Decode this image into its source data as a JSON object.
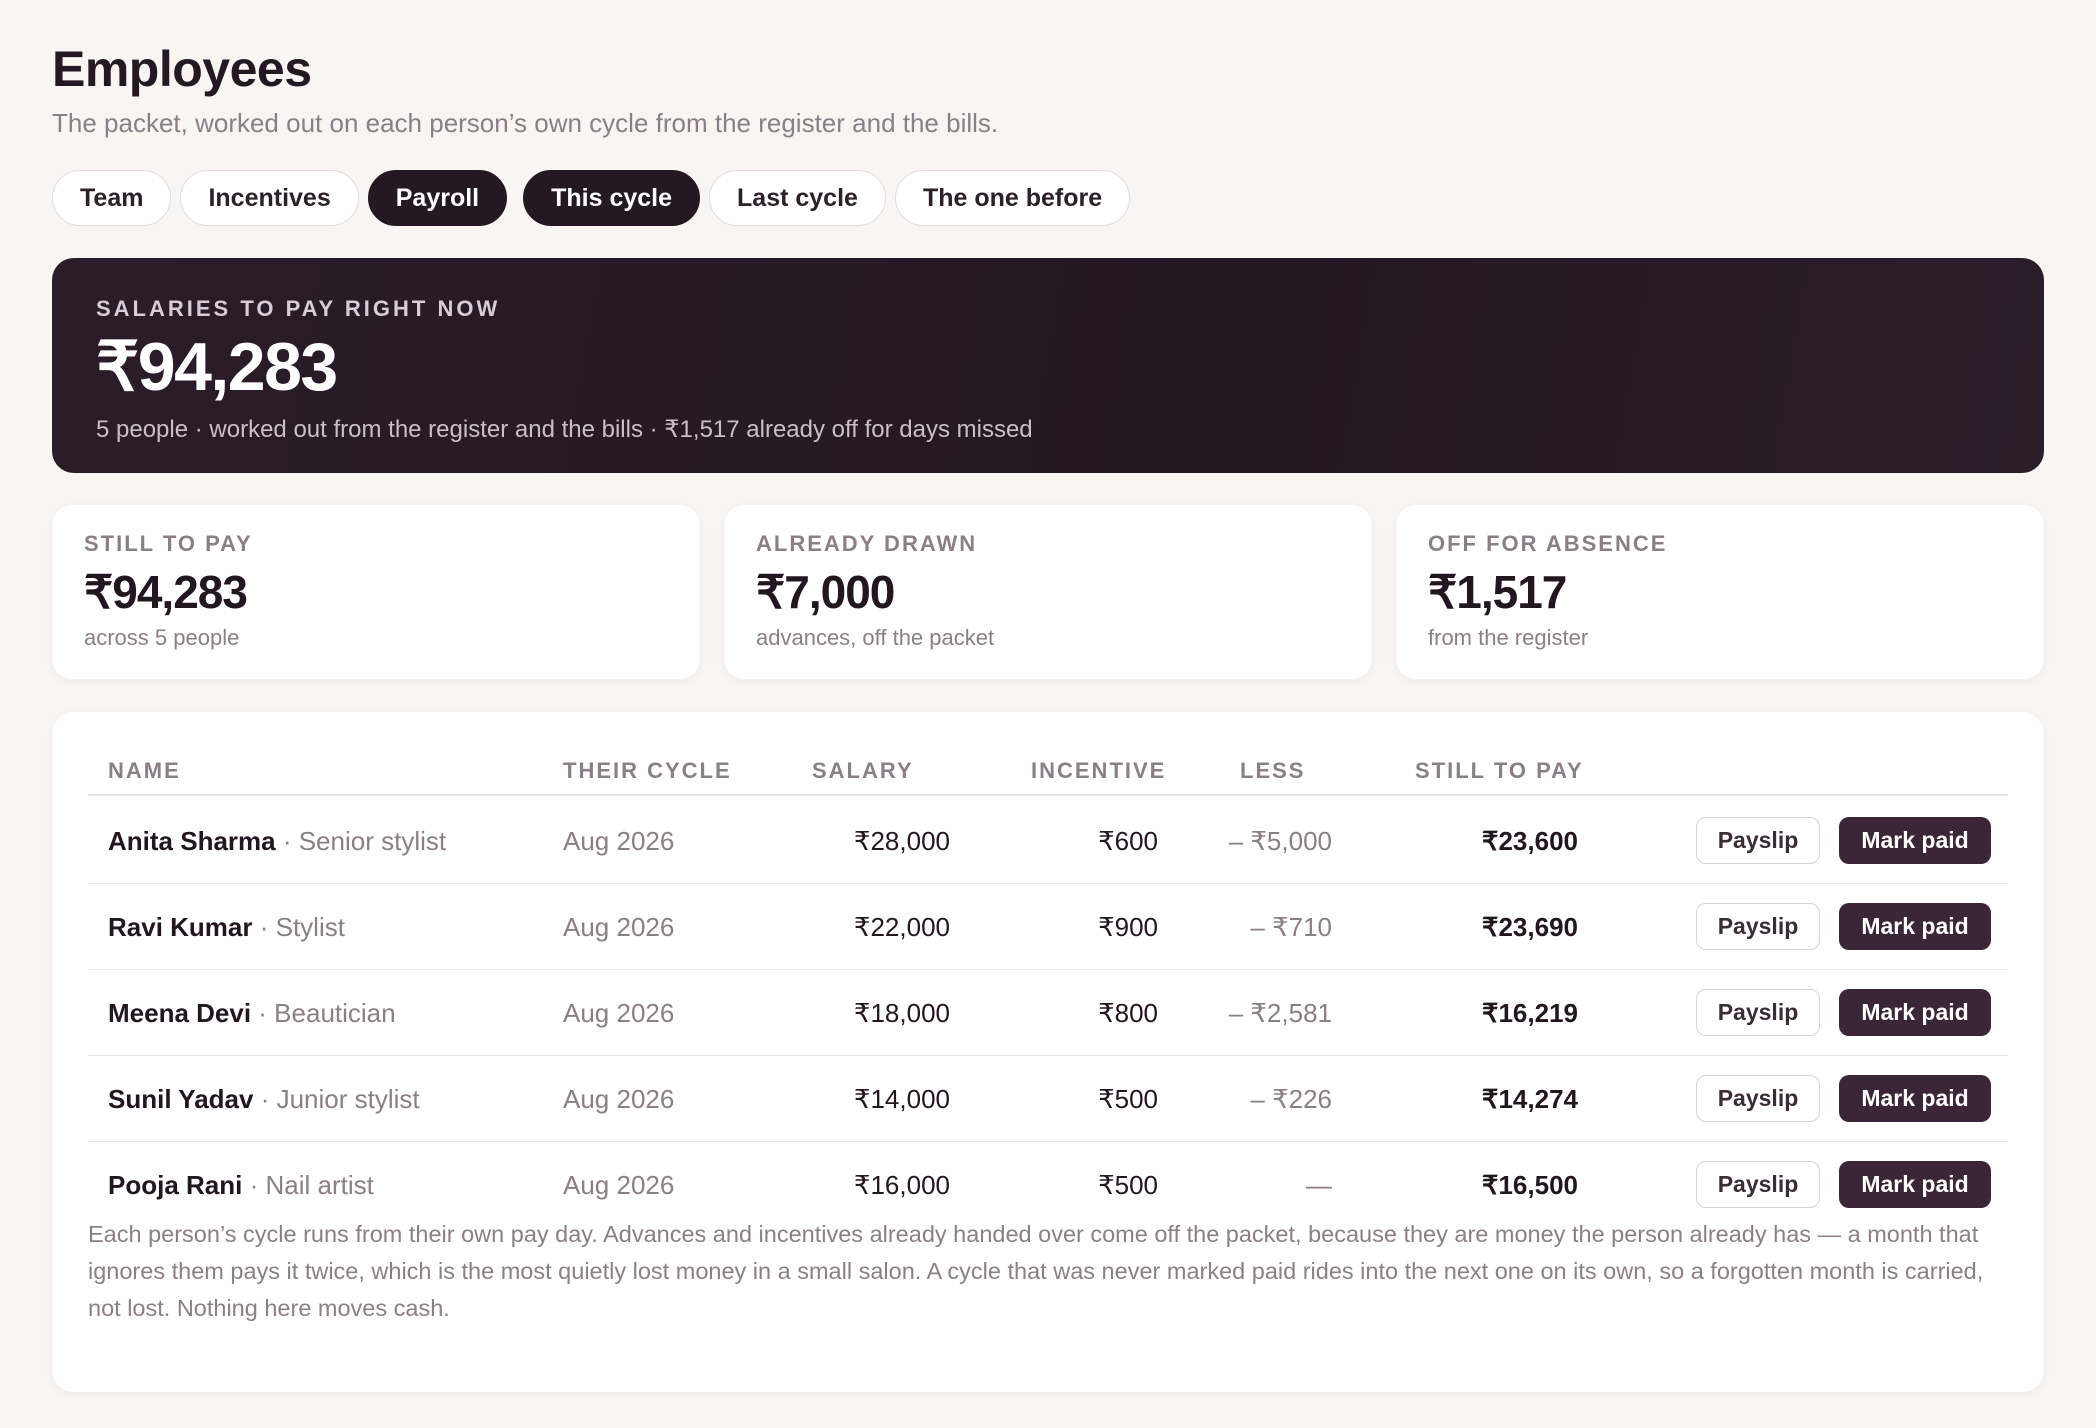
{
  "header": {
    "title": "Employees",
    "subtitle": "The packet, worked out on each person’s own cycle from the register and the bills."
  },
  "tabs": [
    {
      "label": "Team",
      "active": false
    },
    {
      "label": "Incentives",
      "active": false
    },
    {
      "label": "Payroll",
      "active": true
    },
    {
      "label": "This cycle",
      "active": true
    },
    {
      "label": "Last cycle",
      "active": false
    },
    {
      "label": "The one before",
      "active": false
    }
  ],
  "hero": {
    "label": "SALARIES TO PAY RIGHT NOW",
    "value": "₹94,283",
    "sub": "5 people · worked out from the register and the bills · ₹1,517 already off for days missed"
  },
  "cards": [
    {
      "label": "STILL TO PAY",
      "value": "₹94,283",
      "sub": "across 5 people"
    },
    {
      "label": "ALREADY DRAWN",
      "value": "₹7,000",
      "sub": "advances, off the packet"
    },
    {
      "label": "OFF FOR ABSENCE",
      "value": "₹1,517",
      "sub": "from the register"
    }
  ],
  "table": {
    "columns": {
      "name": "NAME",
      "cycle": "THEIR CYCLE",
      "salary": "SALARY",
      "incentive": "INCENTIVE",
      "less": "LESS",
      "topay": "STILL TO PAY"
    },
    "payslip_label": "Payslip",
    "mark_paid_label": "Mark paid",
    "rows": [
      {
        "name": "Anita Sharma",
        "role": " · Senior stylist",
        "cycle": "Aug 2026",
        "salary": "₹28,000",
        "incentive": "₹600",
        "less": "– ₹5,000",
        "topay": "₹23,600"
      },
      {
        "name": "Ravi Kumar",
        "role": " · Stylist",
        "cycle": "Aug 2026",
        "salary": "₹22,000",
        "incentive": "₹900",
        "less": "– ₹710",
        "topay": "₹23,690"
      },
      {
        "name": "Meena Devi",
        "role": " · Beautician",
        "cycle": "Aug 2026",
        "salary": "₹18,000",
        "incentive": "₹800",
        "less": "– ₹2,581",
        "topay": "₹16,219"
      },
      {
        "name": "Sunil Yadav",
        "role": " · Junior stylist",
        "cycle": "Aug 2026",
        "salary": "₹14,000",
        "incentive": "₹500",
        "less": "– ₹226",
        "topay": "₹14,274"
      },
      {
        "name": "Pooja Rani",
        "role": " · Nail artist",
        "cycle": "Aug 2026",
        "salary": "₹16,000",
        "incentive": "₹500",
        "less": "—",
        "topay": "₹16,500"
      }
    ],
    "note": "Each person’s cycle runs from their own pay day. Advances and incentives already handed over come off the packet, because they are money the person already has — a month that ignores them pays it twice, which is the most quietly lost money in a small salon. A cycle that was never marked paid rides into the next one on its own, so a forgotten month is carried, not lost. Nothing here moves cash."
  }
}
